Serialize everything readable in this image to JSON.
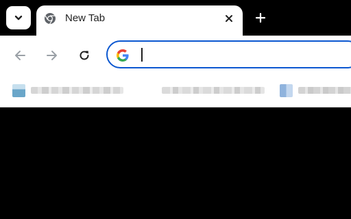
{
  "tab_strip": {
    "tab": {
      "title": "New Tab"
    }
  },
  "toolbar": {
    "omnibox": {
      "value": "",
      "placeholder": ""
    }
  },
  "bookmarks": {
    "items": [
      {
        "label": "",
        "icon_color": "#8bb9d6"
      },
      {
        "label": "",
        "icon_color": "#ffffff"
      },
      {
        "label": "",
        "icon_color": "#a9c3e6"
      }
    ]
  },
  "colors": {
    "accent": "#0b57d0",
    "frame": "#000000",
    "toolbar": "#ffffff"
  }
}
